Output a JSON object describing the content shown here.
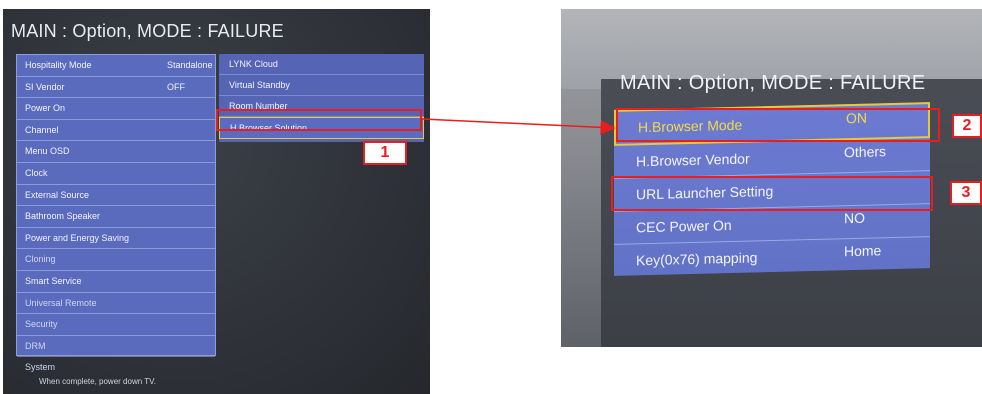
{
  "left_panel": {
    "title": "MAIN : Option, MODE : FAILURE",
    "menu_items": [
      {
        "label": "Hospitality Mode",
        "value": "Standalone"
      },
      {
        "label": "SI Vendor",
        "value": "OFF"
      },
      {
        "label": "Power On",
        "value": ""
      },
      {
        "label": "Channel",
        "value": ""
      },
      {
        "label": "Menu OSD",
        "value": ""
      },
      {
        "label": "Clock",
        "value": ""
      },
      {
        "label": "External Source",
        "value": ""
      },
      {
        "label": "Bathroom Speaker",
        "value": ""
      },
      {
        "label": "Power and Energy Saving",
        "value": ""
      },
      {
        "label": "Cloning",
        "value": ""
      },
      {
        "label": "Smart Service",
        "value": ""
      },
      {
        "label": "Universal Remote",
        "value": ""
      },
      {
        "label": "Security",
        "value": ""
      },
      {
        "label": "DRM",
        "value": ""
      },
      {
        "label": "System",
        "value": ""
      }
    ],
    "submenu_items": [
      {
        "label": "LYNK Cloud"
      },
      {
        "label": "Virtual Standby"
      },
      {
        "label": "Room Number"
      },
      {
        "label": "H.Browser Solution"
      }
    ],
    "footer": "When complete, power down TV."
  },
  "right_panel": {
    "title": "MAIN : Option, MODE : FAILURE",
    "menu_items": [
      {
        "label": "H.Browser Mode",
        "value": "ON"
      },
      {
        "label": "H.Browser Vendor",
        "value": "Others"
      },
      {
        "label": "URL Launcher Setting",
        "value": ""
      },
      {
        "label": "CEC Power On",
        "value": "NO"
      },
      {
        "label": "Key(0x76) mapping",
        "value": "Home"
      }
    ]
  },
  "callouts": {
    "one": "1",
    "two": "2",
    "three": "3"
  },
  "colors": {
    "callout_red": "#e81e1e",
    "selection_yellow": "#e8c93a",
    "menu_blue": "#5a6bbd"
  }
}
